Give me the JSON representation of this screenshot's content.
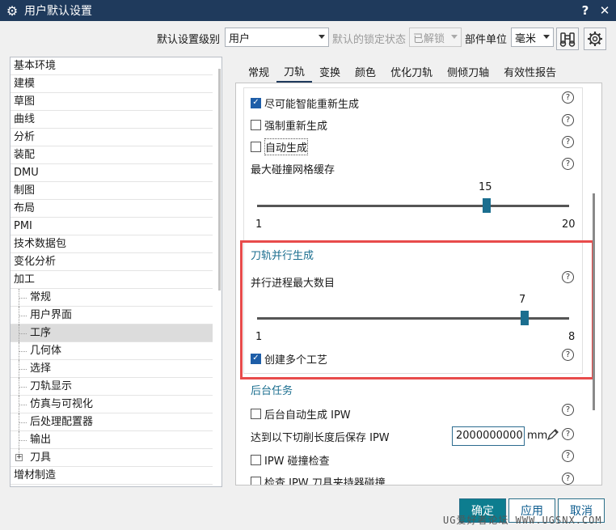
{
  "window": {
    "title": "用户默认设置",
    "help_label": "?",
    "close_label": "✕"
  },
  "toolbar": {
    "level_label": "默认设置级别",
    "level_value": "用户",
    "lock_label": "默认的锁定状态",
    "lock_value": "已解锁",
    "unit_label": "部件单位",
    "unit_value": "毫米"
  },
  "tree": {
    "items": [
      {
        "label": "基本环境"
      },
      {
        "label": "建模"
      },
      {
        "label": "草图"
      },
      {
        "label": "曲线"
      },
      {
        "label": "分析"
      },
      {
        "label": "装配"
      },
      {
        "label": "DMU"
      },
      {
        "label": "制图"
      },
      {
        "label": "布局"
      },
      {
        "label": "PMI"
      },
      {
        "label": "技术数据包"
      },
      {
        "label": "变化分析"
      },
      {
        "label": "加工"
      },
      {
        "label": "常规"
      },
      {
        "label": "用户界面"
      },
      {
        "label": "工序"
      },
      {
        "label": "几何体"
      },
      {
        "label": "选择"
      },
      {
        "label": "刀轨显示"
      },
      {
        "label": "仿真与可视化"
      },
      {
        "label": "后处理配置器"
      },
      {
        "label": "输出"
      },
      {
        "label": "刀具",
        "expander": "+"
      },
      {
        "label": "增材制造"
      }
    ]
  },
  "tabs": [
    {
      "label": "常规"
    },
    {
      "label": "刀轨"
    },
    {
      "label": "变换"
    },
    {
      "label": "颜色"
    },
    {
      "label": "优化刀轨"
    },
    {
      "label": "侧倾刀轴"
    },
    {
      "label": "有效性报告"
    }
  ],
  "panel": {
    "regen_smart": "尽可能智能重新生成",
    "regen_force": "强制重新生成",
    "auto_generate": "自动生成",
    "collision_cache_label": "最大碰撞网格缓存",
    "collision_cache": {
      "value": "15",
      "min": "1",
      "max": "20",
      "fraction": 0.737
    },
    "parallel_section": "刀轨并行生成",
    "parallel_max_label": "并行进程最大数目",
    "parallel_max": {
      "value": "7",
      "min": "1",
      "max": "8",
      "fraction": 0.857
    },
    "create_multi_process": "创建多个工艺",
    "background_section": "后台任务",
    "bg_auto_ipw": "后台自动生成 IPW",
    "ipw_length_label": "达到以下切削长度后保存 IPW",
    "ipw_length_value": "2000000000",
    "ipw_unit": "mm",
    "ipw_collision": "IPW 碰撞检查",
    "tool_holder_check": "检查 IPW 刀具夹持器碰撞",
    "help_glyph": "?"
  },
  "buttons": {
    "ok": "确定",
    "apply": "应用",
    "cancel": "取消"
  },
  "watermark": "UG爱好者论坛 WWW.UGSNX.COM"
}
